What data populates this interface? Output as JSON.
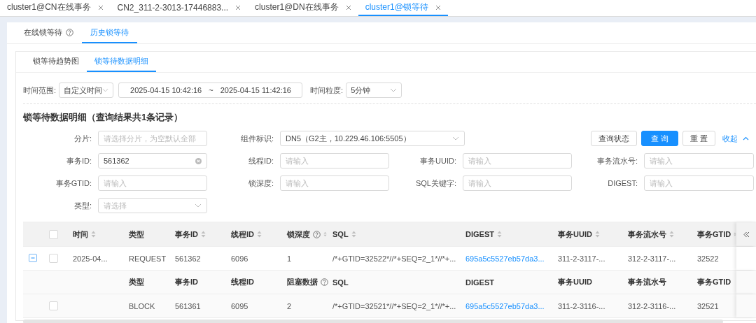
{
  "window_tabs": [
    {
      "label": "cluster1@CN在线事务",
      "selected": false
    },
    {
      "label": "CN2_311-2-3013-17446883...",
      "selected": false
    },
    {
      "label": "cluster1@DN在线事务",
      "selected": false
    },
    {
      "label": "cluster1@锁等待",
      "selected": true
    }
  ],
  "page_tabs": [
    {
      "label": "在线锁等待",
      "help": true,
      "selected": false
    },
    {
      "label": "历史锁等待",
      "help": false,
      "selected": true
    }
  ],
  "sub_tabs": [
    {
      "label": "锁等待趋势图",
      "selected": false
    },
    {
      "label": "锁等待数据明细",
      "selected": true
    }
  ],
  "time_filter": {
    "range_label": "时间范围:",
    "range_value": "自定义时间",
    "start": "2025-04-15 10:42:16",
    "separator": "~",
    "end": "2025-04-15 11:42:16",
    "granularity_label": "时间粒度:",
    "granularity_value": "5分钟"
  },
  "section_title": "锁等待数据明细（查询结果共1条记录）",
  "form_rows": [
    {
      "fields": [
        {
          "label": "分片:",
          "kind": "input",
          "placeholder": "请选择分片，为空默认全部"
        },
        {
          "label": "组件标识:",
          "kind": "select",
          "value": "DN5（G2主，10.229.46.106:5505）"
        }
      ],
      "buttons": [
        {
          "label": "查询状态",
          "kind": "default"
        },
        {
          "label": "查 询",
          "kind": "primary"
        },
        {
          "label": "重 置",
          "kind": "default"
        }
      ],
      "collapse_link": "收起"
    },
    {
      "fields": [
        {
          "label": "事务ID:",
          "kind": "input",
          "value": "561362",
          "clearable": true
        },
        {
          "label": "线程ID:",
          "kind": "input",
          "placeholder": "请输入"
        },
        {
          "label": "事务UUID:",
          "kind": "input",
          "placeholder": "请输入"
        },
        {
          "label": "事务流水号:",
          "kind": "input",
          "placeholder": "请输入"
        }
      ]
    },
    {
      "fields": [
        {
          "label": "事务GTID:",
          "kind": "input",
          "placeholder": "请输入"
        },
        {
          "label": "锁深度:",
          "kind": "input",
          "placeholder": "请输入"
        },
        {
          "label": "SQL关键字:",
          "kind": "input",
          "placeholder": "请输入"
        },
        {
          "label": "DIGEST:",
          "kind": "input",
          "placeholder": "请输入"
        }
      ]
    },
    {
      "fields": [
        {
          "label": "类型:",
          "kind": "select",
          "placeholder": "请选择"
        }
      ]
    }
  ],
  "table": {
    "select_all_checked": false,
    "columns": [
      {
        "label": "时间",
        "sortable": true,
        "help": false
      },
      {
        "label": "类型",
        "sortable": false,
        "help": false
      },
      {
        "label": "事务ID",
        "sortable": true,
        "help": false
      },
      {
        "label": "线程ID",
        "sortable": true,
        "help": false
      },
      {
        "label": "锁深度",
        "sortable": true,
        "help": true
      },
      {
        "label": "SQL",
        "sortable": true,
        "help": false
      },
      {
        "label": "DIGEST",
        "sortable": true,
        "help": false,
        "kind": "link"
      },
      {
        "label": "事务UUID",
        "sortable": true,
        "help": false
      },
      {
        "label": "事务流水号",
        "sortable": true,
        "help": false
      },
      {
        "label": "事务GTID",
        "sortable": true,
        "help": false
      }
    ],
    "rows": [
      {
        "expanded": true,
        "checked": false,
        "cells": [
          "2025-04...",
          "REQUEST",
          "561362",
          "6096",
          "1",
          "/*+GTID=32522*//*+SEQ=2_1*//*+...",
          "695a5c5527eb57da3...",
          "311-2-3117-...",
          "312-2-3117-...",
          "32522"
        ],
        "detail": {
          "columns": [
            {
              "label": "类型",
              "help": false
            },
            {
              "label": "事务ID",
              "help": false
            },
            {
              "label": "线程ID",
              "help": false
            },
            {
              "label": "阻塞数据",
              "help": true
            },
            {
              "label": "SQL",
              "help": false
            },
            {
              "label": "DIGEST",
              "help": false,
              "kind": "link"
            },
            {
              "label": "事务UUID",
              "help": false
            },
            {
              "label": "事务流水号",
              "help": false
            },
            {
              "label": "事务GTID",
              "help": false
            }
          ],
          "rows": [
            {
              "checked": false,
              "cells": [
                "BLOCK",
                "561361",
                "6095",
                "2",
                "/*+GTID=32521*//*+SEQ=2_1*//*+...",
                "695a5c5527eb57da3...",
                "311-2-3116-...",
                "312-2-3116-...",
                "32521"
              ]
            }
          ]
        }
      }
    ]
  }
}
